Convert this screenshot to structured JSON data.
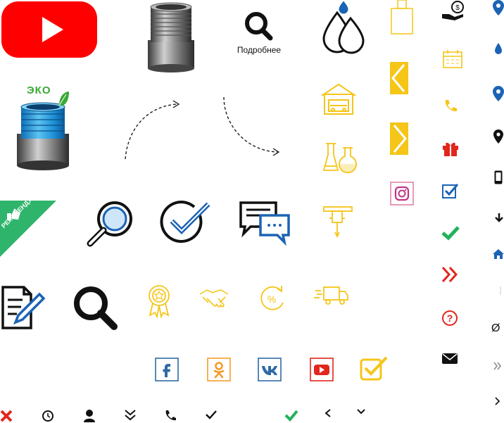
{
  "labels": {
    "details": "Подробнее",
    "eco": "ЭКО",
    "recommend": "РЕКОМЕНДУЕМ",
    "empty_set": "Ø"
  },
  "colors": {
    "youtube_red": "#ff0000",
    "pipe_blue": "#1c8fd6",
    "leaf_green": "#3aa935",
    "ribbon_green": "#2fb56b",
    "gold": "#f5c518",
    "navy": "#1f3a66",
    "blue": "#1b63b5",
    "red": "#e2261c",
    "orange": "#f39c2a",
    "vk_blue": "#2f6aa6",
    "check_green": "#21b25a"
  },
  "icons": [
    "youtube-logo-icon",
    "pipe-fitting-icon",
    "search-details-icon",
    "water-drops-icon",
    "bottle-outline-icon",
    "money-hand-icon",
    "map-pin-icon",
    "eco-pipe-icon",
    "curved-arrow-icon",
    "curved-arrow-down-icon",
    "garage-icon",
    "chevron-left-box-icon",
    "chevron-right-box-icon",
    "calendar-icon",
    "phone-icon",
    "gift-icon",
    "check-box-icon",
    "check-icon",
    "double-chevron-icon",
    "help-icon",
    "envelope-icon",
    "recommend-ribbon-icon",
    "magnifier-icon",
    "check-circle-icon",
    "chat-bubbles-icon",
    "flasks-icon",
    "instagram-icon",
    "jackhammer-icon",
    "document-edit-icon",
    "search-icon",
    "award-icon",
    "handshake-icon",
    "percent-cycle-icon",
    "delivery-truck-icon",
    "facebook-icon",
    "odnoklassniki-icon",
    "vk-icon",
    "youtube-icon",
    "checkbox-yellow-icon",
    "close-icon",
    "clock-icon",
    "user-icon",
    "double-chevron-down-icon",
    "phone-small-icon",
    "check-small-icon",
    "check-green-icon",
    "chevron-left-icon",
    "chevron-down-icon",
    "chevron-right-icon",
    "double-chevron-right-icon",
    "drop-pin-icon",
    "location-pin-icon",
    "mobile-icon",
    "arrow-down-icon",
    "home-icon"
  ]
}
